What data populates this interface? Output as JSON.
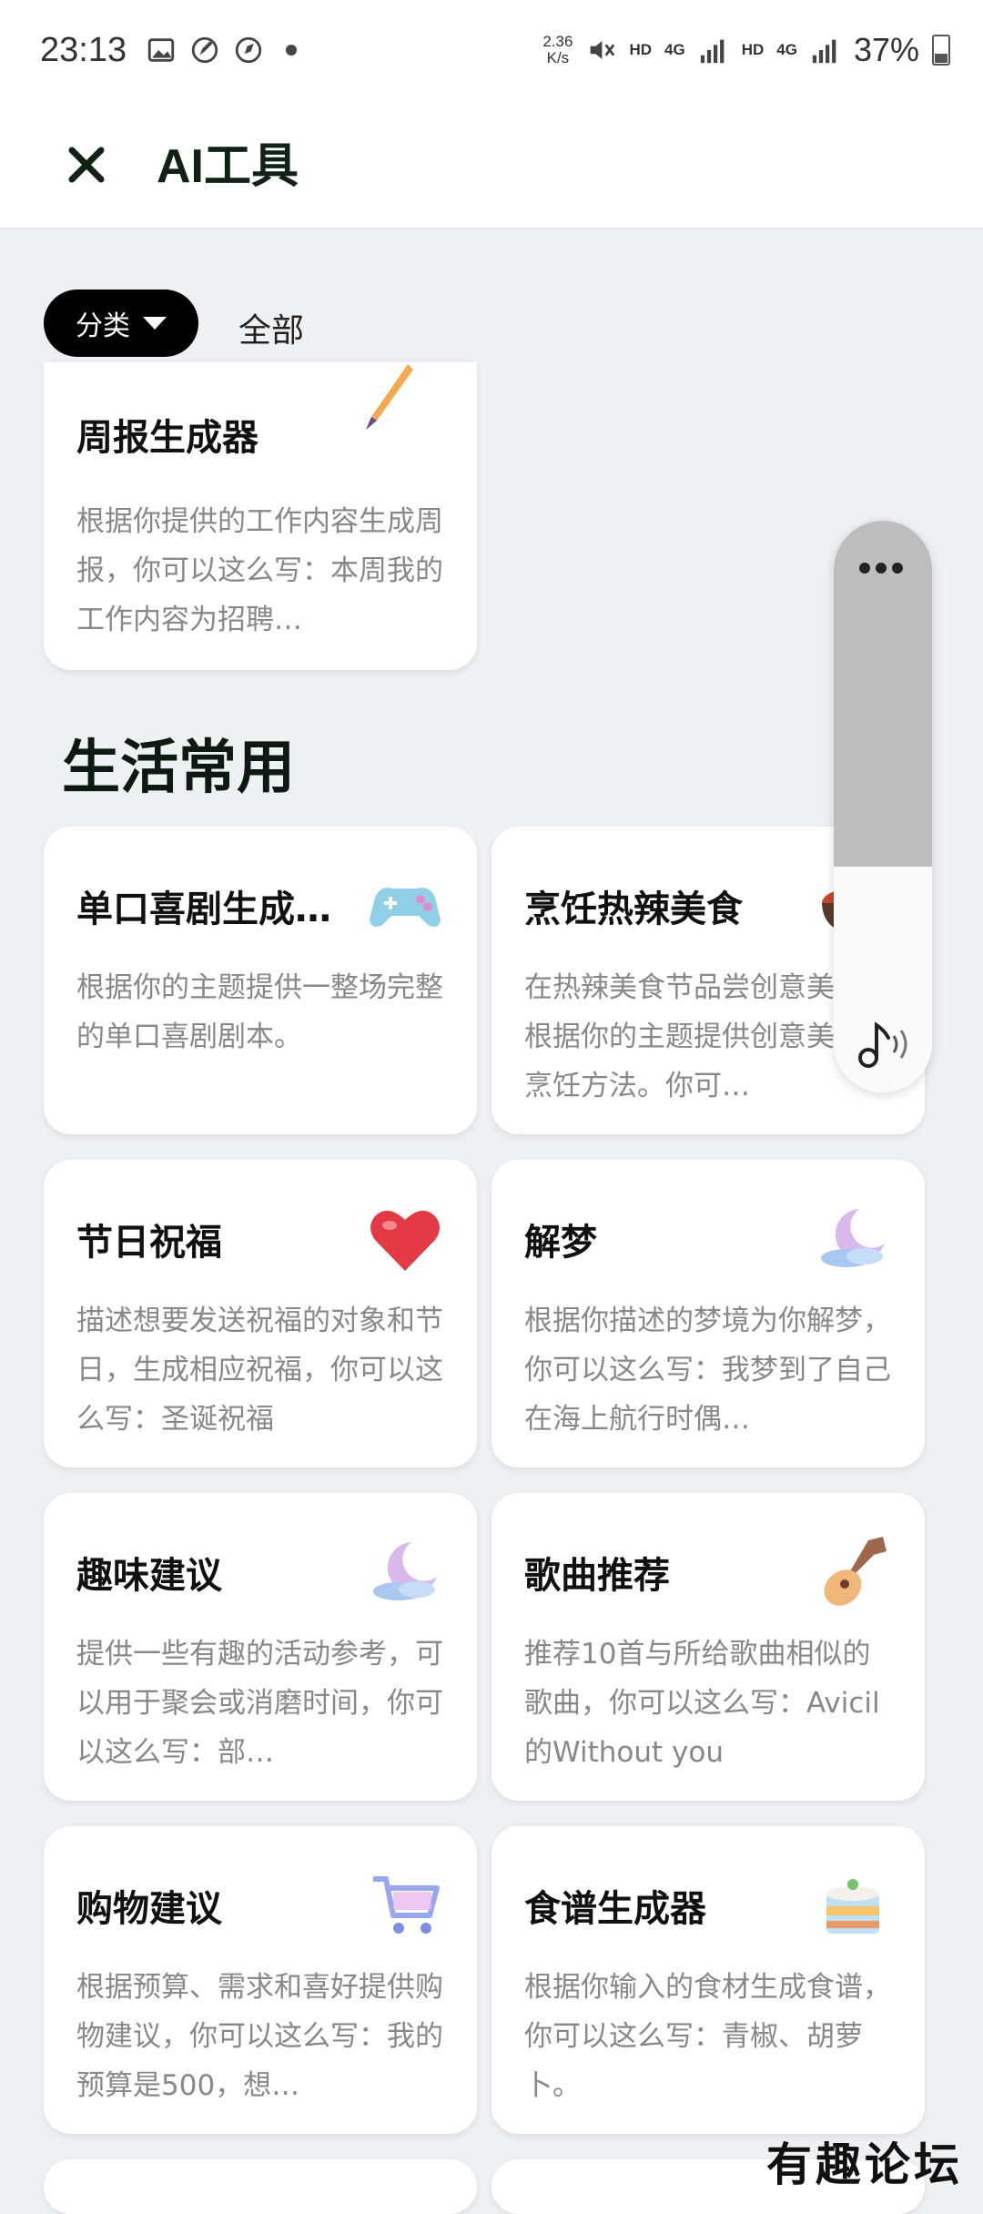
{
  "status_bar": {
    "time": "23:13",
    "speed_value": "2.36",
    "speed_unit": "K/s",
    "hd1": "HD",
    "net1": "4G",
    "hd2": "HD",
    "net2": "4G",
    "battery": "37%"
  },
  "header": {
    "title": "AI工具",
    "close_icon": "close-icon"
  },
  "filter": {
    "category_label": "分类",
    "current": "全部"
  },
  "top_card": {
    "title": "周报生成器",
    "desc": "根据你提供的工作内容生成周报，你可以这么写：本周我的工作内容为招聘…",
    "icon": "pen-icon"
  },
  "section": {
    "title": "生活常用"
  },
  "cards": [
    {
      "title": "单口喜剧生成…",
      "desc": "根据你的主题提供一整场完整的单口喜剧剧本。",
      "icon": "gamepad-icon"
    },
    {
      "title": "烹饪热辣美食",
      "desc": "在热辣美食节品尝创意美食！根据你的主题提供创意美食的烹饪方法。你可…",
      "icon": "hotpot-icon"
    },
    {
      "title": "节日祝福",
      "desc": "描述想要发送祝福的对象和节日，生成相应祝福，你可以这么写：圣诞祝福",
      "icon": "heart-icon"
    },
    {
      "title": "解梦",
      "desc": "根据你描述的梦境为你解梦，你可以这么写：我梦到了自己在海上航行时偶…",
      "icon": "moon-cloud-icon"
    },
    {
      "title": "趣味建议",
      "desc": "提供一些有趣的活动参考，可以用于聚会或消磨时间，你可以这么写：部…",
      "icon": "moon-cloud-icon"
    },
    {
      "title": "歌曲推荐",
      "desc": "推荐10首与所给歌曲相似的歌曲，你可以这么写：Avicil的Without you",
      "icon": "guitar-icon"
    },
    {
      "title": "购物建议",
      "desc": "根据预算、需求和喜好提供购物建议，你可以这么写：我的预算是500，想…",
      "icon": "cart-icon"
    },
    {
      "title": "食谱生成器",
      "desc": "根据你输入的食材生成食谱，你可以这么写：青椒、胡萝卜。",
      "icon": "cake-icon"
    }
  ],
  "floating_widget": {
    "menu_icon": "more-icon",
    "music_icon": "music-note-icon"
  },
  "watermark": "有趣论坛",
  "colors": {
    "background": "#eef1f4",
    "card": "#ffffff",
    "pill": "#000000",
    "title_text": "#102214"
  }
}
